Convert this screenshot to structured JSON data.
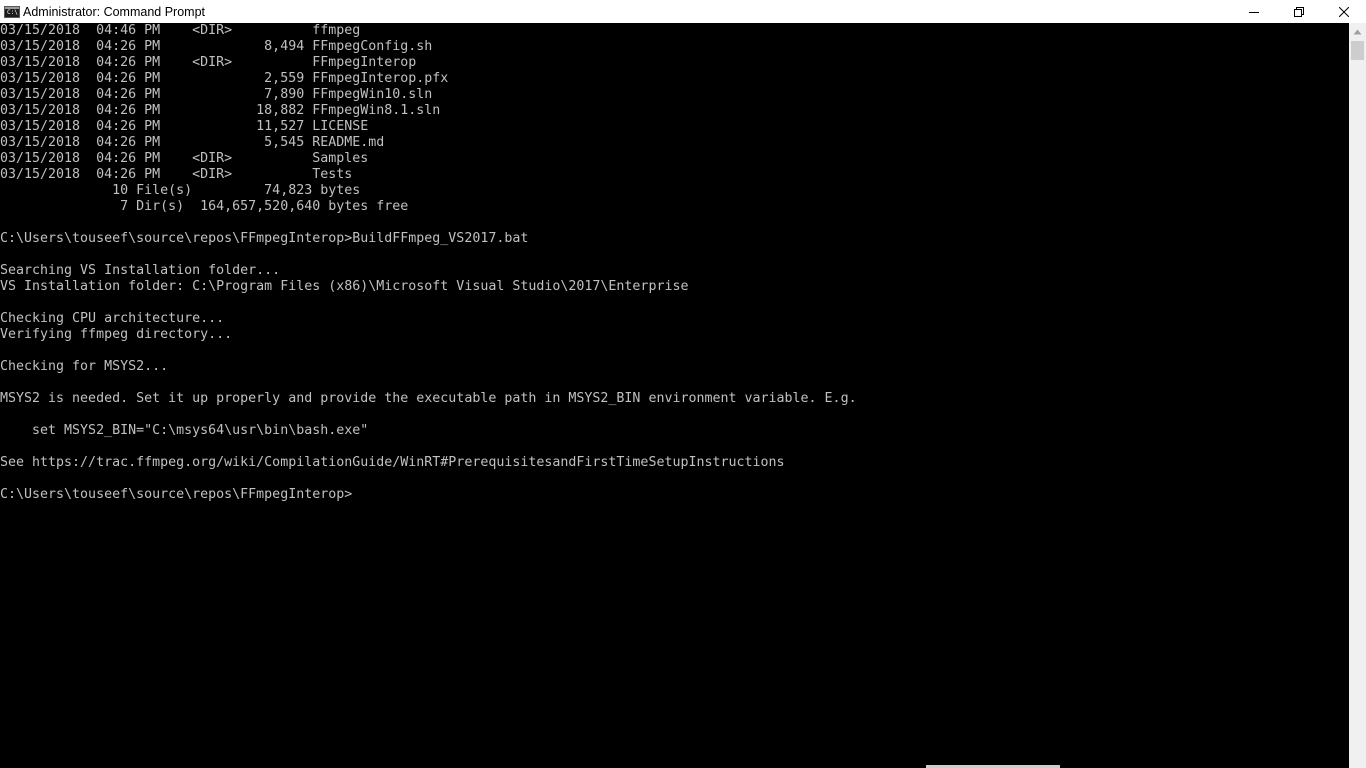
{
  "window": {
    "title": "Administrator: Command Prompt",
    "icon_label": "C:\\"
  },
  "controls": {
    "minimize": "minimize-icon",
    "restore": "restore-icon",
    "close": "close-icon"
  },
  "console": {
    "lines": [
      "03/15/2018  04:46 PM    <DIR>          ffmpeg",
      "03/15/2018  04:26 PM             8,494 FFmpegConfig.sh",
      "03/15/2018  04:26 PM    <DIR>          FFmpegInterop",
      "03/15/2018  04:26 PM             2,559 FFmpegInterop.pfx",
      "03/15/2018  04:26 PM             7,890 FFmpegWin10.sln",
      "03/15/2018  04:26 PM            18,882 FFmpegWin8.1.sln",
      "03/15/2018  04:26 PM            11,527 LICENSE",
      "03/15/2018  04:26 PM             5,545 README.md",
      "03/15/2018  04:26 PM    <DIR>          Samples",
      "03/15/2018  04:26 PM    <DIR>          Tests",
      "              10 File(s)         74,823 bytes",
      "               7 Dir(s)  164,657,520,640 bytes free",
      "",
      "C:\\Users\\touseef\\source\\repos\\FFmpegInterop>BuildFFmpeg_VS2017.bat",
      "",
      "Searching VS Installation folder...",
      "VS Installation folder: C:\\Program Files (x86)\\Microsoft Visual Studio\\2017\\Enterprise",
      "",
      "Checking CPU architecture...",
      "Verifying ffmpeg directory...",
      "",
      "Checking for MSYS2...",
      "",
      "MSYS2 is needed. Set it up properly and provide the executable path in MSYS2_BIN environment variable. E.g.",
      "",
      "    set MSYS2_BIN=\"C:\\msys64\\usr\\bin\\bash.exe\"",
      "",
      "See https://trac.ffmpeg.org/wiki/CompilationGuide/WinRT#PrerequisitesandFirstTimeSetupInstructions",
      "",
      "C:\\Users\\touseef\\source\\repos\\FFmpegInterop>"
    ]
  },
  "colors": {
    "console_background": "#000000",
    "console_text": "#c0c0c0",
    "titlebar_background": "#ffffff",
    "scrollbar_track": "#f0f0f0",
    "scrollbar_thumb": "#cdcdcd"
  }
}
